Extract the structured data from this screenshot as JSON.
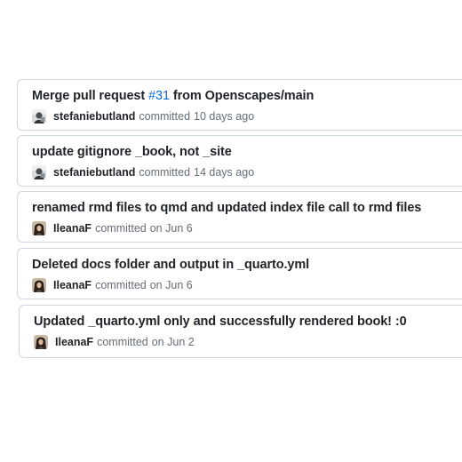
{
  "commits": [
    {
      "title_before": "Merge pull request ",
      "pr_link": "#31",
      "title_after": " from Openscapes/main",
      "author": "stefaniebutland",
      "action": "committed",
      "time": "10 days ago",
      "avatar_icon": "user-avatar-stefaniebutland"
    },
    {
      "title": "update gitignore _book, not _site",
      "author": "stefaniebutland",
      "action": "committed",
      "time": "14 days ago",
      "avatar_icon": "user-avatar-stefaniebutland"
    },
    {
      "title": "renamed rmd files to qmd and updated index file call to rmd files",
      "author": "IleanaF",
      "action": "committed",
      "time": "on Jun 6",
      "avatar_icon": "user-avatar-ileanaf"
    },
    {
      "title": "Deleted docs folder and output in _quarto.yml",
      "author": "IleanaF",
      "action": "committed",
      "time": "on Jun 6",
      "avatar_icon": "user-avatar-ileanaf"
    },
    {
      "title": "Updated _quarto.yml only and successfully rendered book! :0",
      "author": "IleanaF",
      "action": "committed",
      "time": "on Jun 2",
      "avatar_icon": "user-avatar-ileanaf"
    }
  ],
  "colors": {
    "link": "#0969da",
    "text": "#1f2328",
    "muted": "#656d76",
    "border": "#d0d7de"
  }
}
